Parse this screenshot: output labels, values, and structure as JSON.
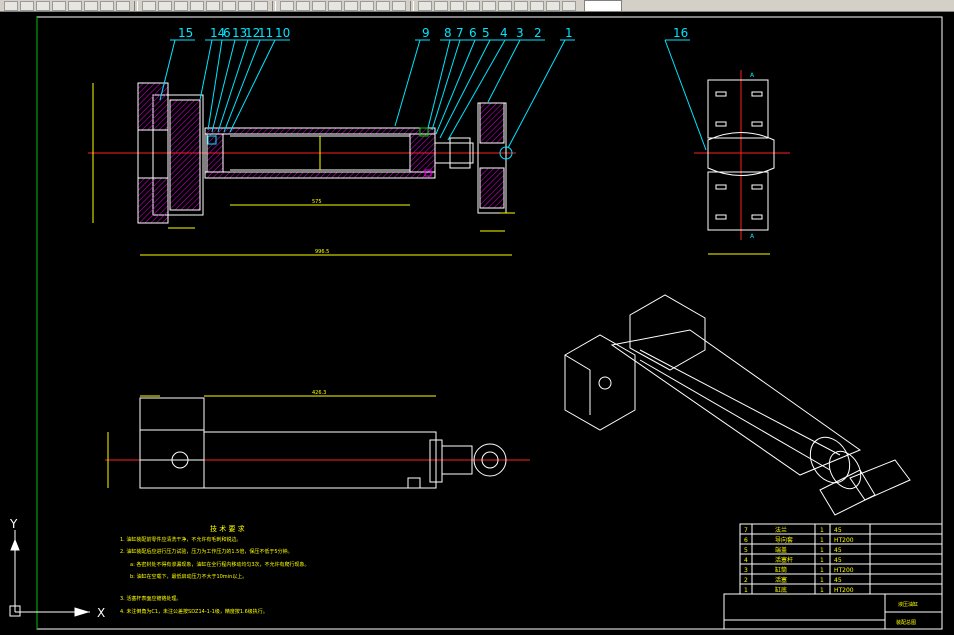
{
  "toolbar": {
    "button_count": 34
  },
  "balloons": {
    "front_view": [
      "15",
      "14",
      "6",
      "13",
      "12",
      "11",
      "10",
      "9",
      "8",
      "7",
      "6",
      "5",
      "4",
      "3",
      "2",
      "1"
    ],
    "side_view": "16"
  },
  "dimensions": {
    "overall_length": "996.5",
    "rod_stroke": "575",
    "body_length": "426.3"
  },
  "notes": {
    "title": "技 术 要 求",
    "lines": [
      "1.  油缸装配前零件应清洗干净，不允许有毛刺和锐边。",
      "2.  油缸装配后应进行压力试验，压力为工作压力的1.5倍，保压不低于5分钟。",
      "a: 各密封处不得有渗漏现象，油缸在全行程内移动均匀3次，不允许有爬行现象。",
      "b: 油缸在空载下，最低启动压力不大于10min以上。",
      "3.  活塞杆表面应镀铬处理。",
      "4.  未注倒角为C1，未注公差按SDZ14-1-1级，精度按1.6级执行。"
    ]
  },
  "bom": {
    "rows": [
      {
        "no": "7",
        "name": "法兰",
        "qty": "1",
        "mat": "45"
      },
      {
        "no": "6",
        "name": "导向套",
        "qty": "1",
        "mat": "HT200"
      },
      {
        "no": "5",
        "name": "端盖",
        "qty": "1",
        "mat": "45"
      },
      {
        "no": "4",
        "name": "活塞杆",
        "qty": "1",
        "mat": "45"
      },
      {
        "no": "3",
        "name": "缸筒",
        "qty": "1",
        "mat": "HT200"
      },
      {
        "no": "2",
        "name": "活塞",
        "qty": "1",
        "mat": "45"
      },
      {
        "no": "1",
        "name": "缸底",
        "qty": "1",
        "mat": "HT200"
      }
    ],
    "title_block": {
      "drawing_name": "液压油缸",
      "drawing_code": "装配总图"
    }
  },
  "ucs": {
    "x_label": "X",
    "y_label": "Y"
  }
}
